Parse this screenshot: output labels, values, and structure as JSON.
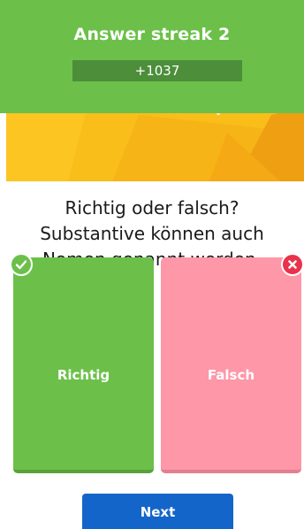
{
  "streak": {
    "title": "Answer streak 2",
    "points": "+1037"
  },
  "question": {
    "line1": "Richtig oder falsch?",
    "line2": "Substantive können auch",
    "line3": "Nomen genannt werden."
  },
  "answers": [
    {
      "label": "Richtig",
      "status": "correct",
      "color": "#6cc04a",
      "icon": "check-icon"
    },
    {
      "label": "Falsch",
      "status": "wrong",
      "color": "#fe97a7",
      "icon": "close-icon"
    }
  ],
  "next": {
    "label": "Next",
    "color": "#1365c9"
  },
  "colors": {
    "streak_banner": "#6cc04a",
    "points_bar": "#4c8e3a",
    "hero_background": "#f9be1a",
    "badge_correct": "#6cc04a",
    "badge_wrong": "#e8334a"
  }
}
